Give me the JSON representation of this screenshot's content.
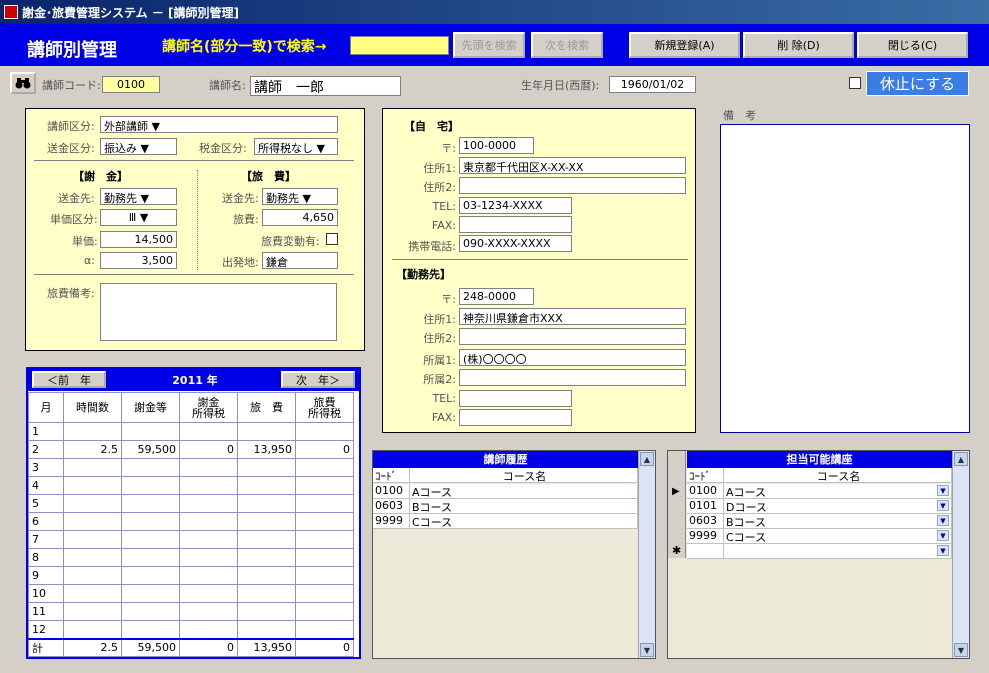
{
  "window": {
    "title": "謝金･旅費管理システム － [講師別管理]"
  },
  "header": {
    "form_title": "講師別管理",
    "search_label": "講師名(部分一致)で検索→",
    "search_value": "",
    "first_search": "先頭を検索",
    "next_search": "次を検索",
    "new_button": "新規登録(A)",
    "delete_button": "削 除(D)",
    "close_button": "閉じる(C)"
  },
  "instructor": {
    "code_label": "講師コード:",
    "code": "0100",
    "name_label": "講師名:",
    "name": "講師　一郎",
    "birth_label": "生年月日(西暦):",
    "birth": "1960/01/02",
    "suspend_label": "休止にする"
  },
  "left_panel": {
    "kubun_label": "講師区分:",
    "kubun": "外部講師",
    "soukin_kubun_label": "送金区分:",
    "soukin_kubun": "振込み",
    "zeikin_kubun_label": "税金区分:",
    "zeikin_kubun": "所得税なし",
    "shakin_header": "【謝　金】",
    "ryohi_header": "【旅　費】",
    "shakin_soukin_label": "送金先:",
    "shakin_soukin": "勤務先",
    "tanka_kubun_label": "単価区分:",
    "tanka_kubun": "Ⅲ",
    "tanka_label": "単価:",
    "tanka": "14,500",
    "alpha_label": "α:",
    "alpha": "3,500",
    "ryohi_soukin_label": "送金先:",
    "ryohi_soukin": "勤務先",
    "ryohi_label": "旅費:",
    "ryohi": "4,650",
    "ryohi_hendo_label": "旅費変動有:",
    "shuppatsu_label": "出発地:",
    "shuppatsu": "鎌倉",
    "biko_label": "旅費備考:"
  },
  "address": {
    "home_header": "【自　宅】",
    "zip_label": "〒:",
    "zip": "100-0000",
    "addr1_label": "住所1:",
    "addr1": "東京都千代田区X-XX-XX",
    "addr2_label": "住所2:",
    "addr2": "",
    "tel_label": "TEL:",
    "tel": "03-1234-XXXX",
    "fax_label": "FAX:",
    "fax": "",
    "mobile_label": "携帯電話:",
    "mobile": "090-XXXX-XXXX",
    "work_header": "【勤務先】",
    "work_zip_label": "〒:",
    "work_zip": "248-0000",
    "work_addr1_label": "住所1:",
    "work_addr1": "神奈川県鎌倉市XXX",
    "work_addr2_label": "住所2:",
    "work_addr2": "",
    "dept1_label": "所属1:",
    "dept1": "(株)〇〇〇〇",
    "dept2_label": "所属2:",
    "dept2": "",
    "work_tel_label": "TEL:",
    "work_tel": "",
    "work_fax_label": "FAX:",
    "work_fax": ""
  },
  "notes": {
    "label": "備　考"
  },
  "calendar": {
    "prev": "＜前　年",
    "year": "2011 年",
    "next": "次　年＞",
    "columns": [
      "月",
      "時間数",
      "謝金等",
      "謝金\n所得税",
      "旅　費",
      "旅費\n所得税"
    ],
    "rows": [
      [
        "1",
        "",
        "",
        "",
        "",
        ""
      ],
      [
        "2",
        "2.5",
        "59,500",
        "0",
        "13,950",
        "0"
      ],
      [
        "3",
        "",
        "",
        "",
        "",
        ""
      ],
      [
        "4",
        "",
        "",
        "",
        "",
        ""
      ],
      [
        "5",
        "",
        "",
        "",
        "",
        ""
      ],
      [
        "6",
        "",
        "",
        "",
        "",
        ""
      ],
      [
        "7",
        "",
        "",
        "",
        "",
        ""
      ],
      [
        "8",
        "",
        "",
        "",
        "",
        ""
      ],
      [
        "9",
        "",
        "",
        "",
        "",
        ""
      ],
      [
        "10",
        "",
        "",
        "",
        "",
        ""
      ],
      [
        "11",
        "",
        "",
        "",
        "",
        ""
      ],
      [
        "12",
        "",
        "",
        "",
        "",
        ""
      ]
    ],
    "total": [
      "計",
      "2.5",
      "59,500",
      "0",
      "13,950",
      "0"
    ]
  },
  "history": {
    "title": "講師履歴",
    "col_code": "ｺｰﾄﾞ",
    "col_name": "コース名",
    "rows": [
      {
        "code": "0100",
        "name": "Aコース"
      },
      {
        "code": "0603",
        "name": "Bコース"
      },
      {
        "code": "9999",
        "name": "Cコース"
      }
    ]
  },
  "available": {
    "title": "担当可能講座",
    "col_code": "ｺｰﾄﾞ",
    "col_name": "コース名",
    "rows": [
      {
        "code": "0100",
        "name": "Aコース"
      },
      {
        "code": "0101",
        "name": "Dコース"
      },
      {
        "code": "0603",
        "name": "Bコース"
      },
      {
        "code": "9999",
        "name": "Cコース"
      }
    ]
  },
  "colors": {
    "header_blue": "#0000e6",
    "panel_yellow": "#ffffc8",
    "search_yellow": "#ffff00"
  }
}
